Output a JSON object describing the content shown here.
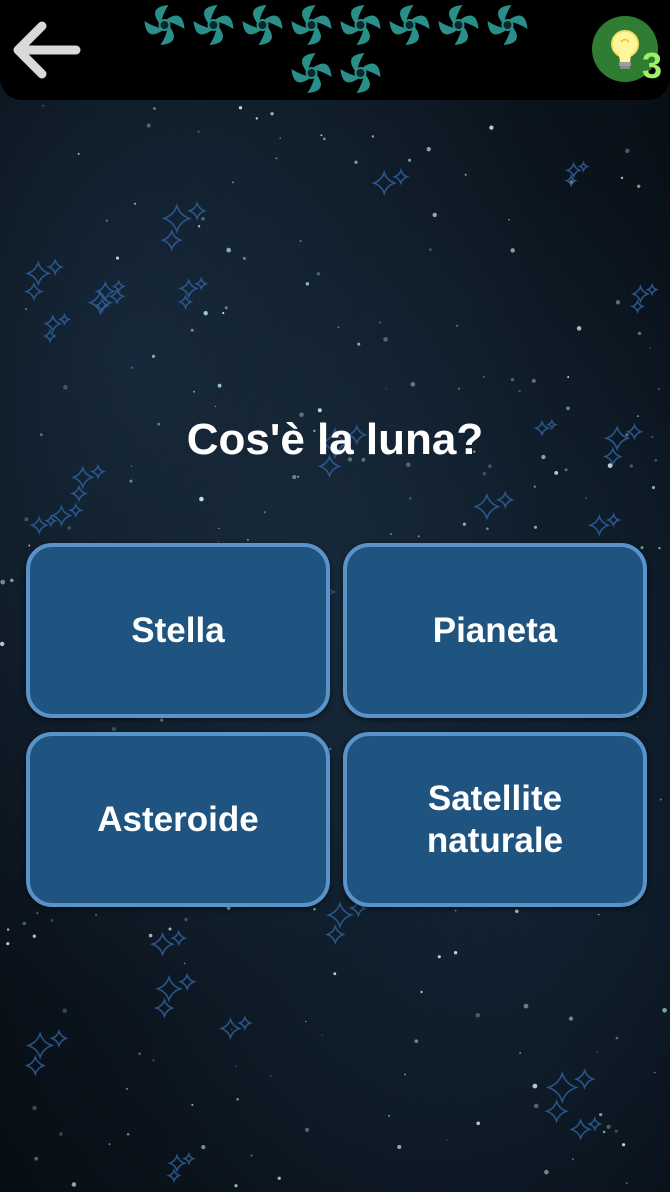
{
  "header": {
    "back_icon": "arrow-left-icon",
    "progress_icon": "spiral-galaxy-icon",
    "progress_count": 10,
    "hint_icon": "lightbulb-icon",
    "hint_count": "3"
  },
  "quiz": {
    "question": "Cos'è la luna?",
    "answers": [
      {
        "label": "Stella"
      },
      {
        "label": "Pianeta"
      },
      {
        "label": "Asteroide"
      },
      {
        "label": "Satellite naturale"
      }
    ]
  },
  "colors": {
    "top_bar": "#000000",
    "answer_fill": "#1f5480",
    "answer_border": "#5a93c9",
    "hint_circle": "#2e7d32",
    "hint_count": "#9ef068",
    "galaxy_icon": "#2a8f89"
  }
}
